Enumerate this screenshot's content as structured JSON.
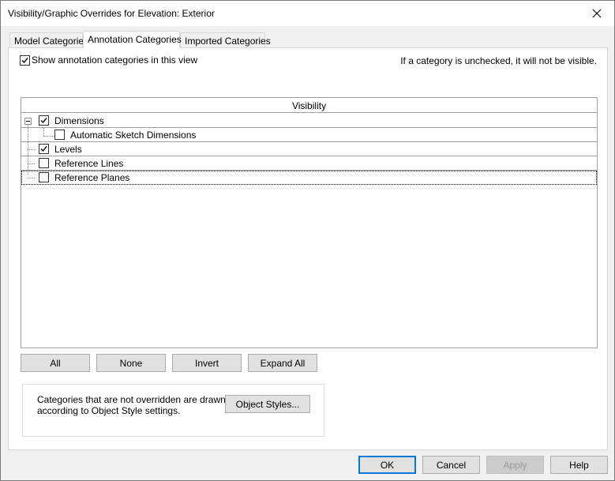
{
  "window": {
    "title": "Visibility/Graphic Overrides for Elevation: Exterior"
  },
  "tabs": [
    {
      "label": "Model Categories",
      "active": false
    },
    {
      "label": "Annotation Categories",
      "active": true
    },
    {
      "label": "Imported Categories",
      "active": false
    }
  ],
  "panel": {
    "show_label": "Show annotation categories in this view",
    "show_checked": true,
    "hint": "If a category is unchecked, it will not be visible.",
    "grid": {
      "column_header": "Visibility",
      "rows": [
        {
          "label": "Dimensions",
          "checked": true,
          "level": 0,
          "expandable": true
        },
        {
          "label": "Automatic Sketch Dimensions",
          "checked": false,
          "level": 1,
          "expandable": false
        },
        {
          "label": "Levels",
          "checked": true,
          "level": 0,
          "expandable": false
        },
        {
          "label": "Reference Lines",
          "checked": false,
          "level": 0,
          "expandable": false
        },
        {
          "label": "Reference Planes",
          "checked": false,
          "level": 0,
          "expandable": false
        }
      ]
    },
    "buttons": {
      "all": "All",
      "none": "None",
      "invert": "Invert",
      "expand_all": "Expand All"
    },
    "note": {
      "text": "Categories that are not overridden are drawn according to Object Style settings.",
      "object_styles_button": "Object Styles..."
    }
  },
  "footer": {
    "ok": "OK",
    "cancel": "Cancel",
    "apply": "Apply",
    "help": "Help"
  },
  "icons": {
    "close": "close-icon",
    "check": "checkmark-icon",
    "collapse": "collapse-minus-icon"
  }
}
